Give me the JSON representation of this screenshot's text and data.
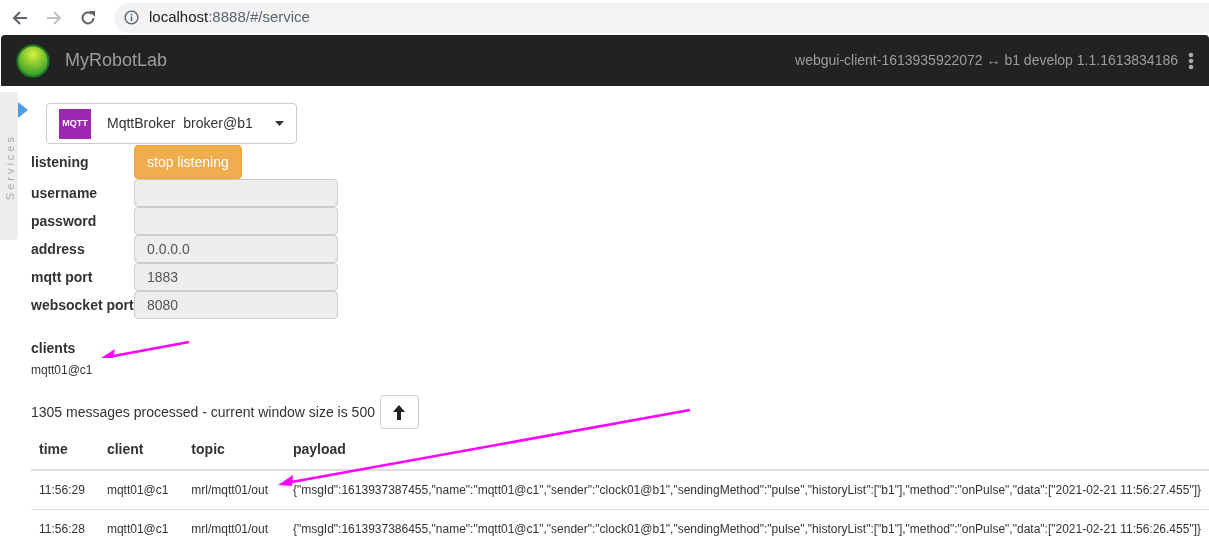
{
  "browser": {
    "host": "localhost",
    "path": ":8888/#/service"
  },
  "navbar": {
    "title": "MyRobotLab",
    "connection": "webgui-client-1613935922072 ↔ b1 develop 1.1.1613834186"
  },
  "sidebar": {
    "label": "Services"
  },
  "service": {
    "badge": "MQTT",
    "type": "MqttBroker",
    "name": "broker@b1"
  },
  "form": [
    {
      "kind": "button",
      "label": "listening",
      "value": "stop listening"
    },
    {
      "kind": "field",
      "label": "username"
    },
    {
      "kind": "field",
      "label": "password"
    },
    {
      "kind": "field",
      "label": "address",
      "value": "0.0.0.0"
    },
    {
      "kind": "field",
      "label": "mqtt port",
      "value": "1883"
    },
    {
      "kind": "field",
      "label": "websocket port",
      "value": "8080"
    }
  ],
  "clients": {
    "title": "clients",
    "items": [
      "mqtt01@c1"
    ]
  },
  "status": "1305 messages processed - current window size is 500",
  "table": {
    "columns": [
      "time",
      "client",
      "topic",
      "payload"
    ],
    "rows": [
      [
        "11:56:29",
        "mqtt01@c1",
        "mrl/mqtt01/out",
        "{\"msgId\":1613937387455,\"name\":\"mqtt01@c1\",\"sender\":\"clock01@b1\",\"sendingMethod\":\"pulse\",\"historyList\":[\"b1\"],\"method\":\"onPulse\",\"data\":[\"2021-02-21 11:56:27.455\"]}"
      ],
      [
        "11:56:28",
        "mqtt01@c1",
        "mrl/mqtt01/out",
        "{\"msgId\":1613937386455,\"name\":\"mqtt01@c1\",\"sender\":\"clock01@b1\",\"sendingMethod\":\"pulse\",\"historyList\":[\"b1\"],\"method\":\"onPulse\",\"data\":[\"2021-02-21 11:56:26.455\"]}"
      ]
    ]
  }
}
